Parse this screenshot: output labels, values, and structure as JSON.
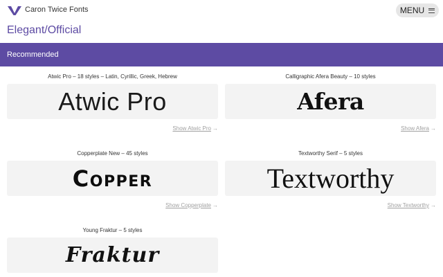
{
  "header": {
    "brand": "Caron Twice Fonts",
    "menu_label": "MENU",
    "logo_icon": "caron-logo-icon",
    "menu_icon": "hamburger-icon"
  },
  "page": {
    "title": "Elegant/Official"
  },
  "section": {
    "label": "Recommended"
  },
  "fonts": [
    {
      "meta": "Atwic Pro – 18 styles – Latin, Cyrillic, Greek, Hebrew",
      "sample": "Atwic Pro",
      "link": "Show Atwic Pro"
    },
    {
      "meta": "Calligraphic Afera Beauty – 10 styles",
      "sample": "Afera",
      "link": "Show Afera"
    },
    {
      "meta": "Copperplate New – 45 styles",
      "sample": "Copper",
      "link": "Show Copperplate"
    },
    {
      "meta": "Textworthy Serif – 5 styles",
      "sample": "Textworthy",
      "link": "Show Textworthy"
    },
    {
      "meta": "Young Fraktur – 5 styles",
      "sample": "Fraktur",
      "link": ""
    }
  ],
  "link_arrow": "→",
  "colors": {
    "accent": "#5d4ba3",
    "card_bg": "#f3f3f3",
    "link": "#a0a0a0"
  }
}
